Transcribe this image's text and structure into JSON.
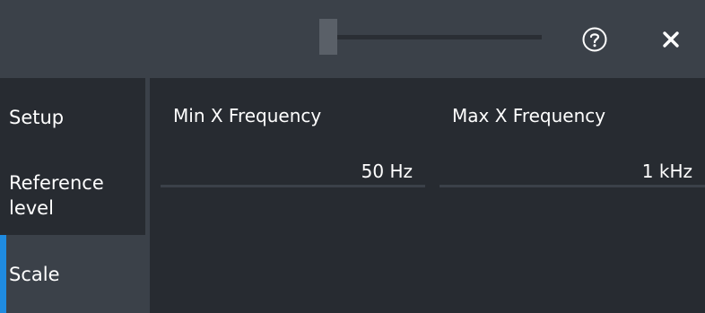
{
  "window": {
    "help_icon": "help-circle-icon",
    "close_icon": "close-icon",
    "zoom_slider_level": 0.05
  },
  "sidebar": {
    "items": [
      {
        "label": "Setup",
        "selected": false
      },
      {
        "label": "Reference level",
        "selected": false
      },
      {
        "label": "Scale",
        "selected": true
      }
    ],
    "accent_color": "#1f8be0"
  },
  "fields": {
    "min_x_frequency": {
      "label": "Min X Frequency",
      "value": "50 Hz"
    },
    "max_x_frequency": {
      "label": "Max X Frequency",
      "value": "1 kHz"
    }
  },
  "colors": {
    "titlebar": "#3b4149",
    "background": "#272b31",
    "text": "#ffffff"
  }
}
